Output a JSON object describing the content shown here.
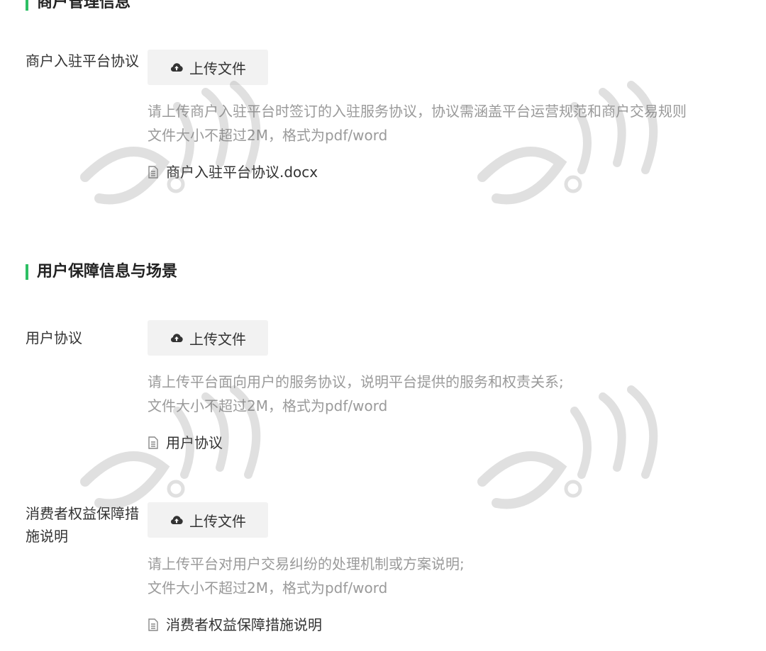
{
  "sections": {
    "merchant": {
      "title": "商户管理信息",
      "fields": [
        {
          "label": "商户入驻平台协议",
          "upload_label": "上传文件",
          "hint_line1": "请上传商户入驻平台时签订的入驻服务协议，协议需涵盖平台运营规范和商户交易规则",
          "hint_line2": "文件大小不超过2M，格式为pdf/word",
          "file_name": "商户入驻平台协议.docx"
        }
      ]
    },
    "user": {
      "title": "用户保障信息与场景",
      "fields": [
        {
          "label": "用户协议",
          "upload_label": "上传文件",
          "hint_line1": "请上传平台面向用户的服务协议，说明平台提供的服务和权责关系;",
          "hint_line2": "文件大小不超过2M，格式为pdf/word",
          "file_name": "用户协议"
        },
        {
          "label": "消费者权益保障措施说明",
          "upload_label": "上传文件",
          "hint_line1": "请上传平台对用户交易纠纷的处理机制或方案说明;",
          "hint_line2": "文件大小不超过2M，格式为pdf/word",
          "file_name": "消费者权益保障措施说明"
        }
      ]
    }
  },
  "colors": {
    "accent": "#2dbf64",
    "hint": "#9a9a9a",
    "button_bg": "#f2f2f2"
  },
  "icons": {
    "upload": "cloud-upload-icon",
    "file": "document-icon"
  }
}
